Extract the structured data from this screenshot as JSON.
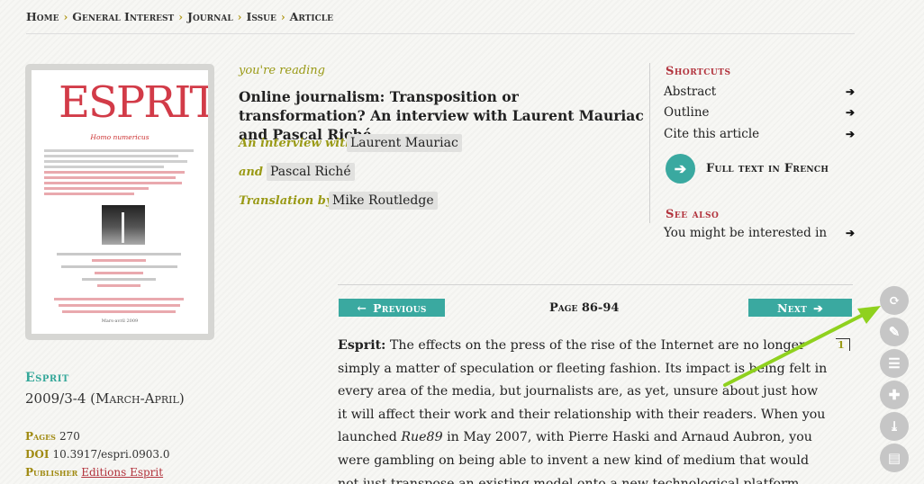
{
  "breadcrumb": {
    "items": [
      "Home",
      "General Interest",
      "Journal",
      "Issue",
      "Article"
    ],
    "sep": "›"
  },
  "cover": {
    "logo": "ESPRIT",
    "subtitle": "Homo numericus",
    "date": "Mars-avril 2009"
  },
  "journal": {
    "name": "Esprit",
    "issue": "2009/3-4 (March-April)",
    "pages_label": "Pages",
    "pages_value": "270",
    "doi_label": "DOI",
    "doi_value": "10.3917/espri.0903.0",
    "publisher_label": "Publisher",
    "publisher_value": "Editions Esprit"
  },
  "article": {
    "reading_label": "you're reading",
    "title": "Online journalism: Transposition or transformation? An interview with Laurent Mauriac and Pascal Riché",
    "roles": [
      {
        "label": "An interview with",
        "person": "Laurent Mauriac"
      },
      {
        "label": "and",
        "person": "Pascal Riché"
      },
      {
        "label": "Translation by",
        "person": "Mike Routledge"
      }
    ]
  },
  "shortcuts": {
    "heading": "Shortcuts",
    "items": [
      "Abstract",
      "Outline",
      "Cite this article"
    ],
    "fulltext": "Full text in French",
    "see_also_heading": "See also",
    "see_also_item": "You might be interested in",
    "arrow": "➔"
  },
  "nav": {
    "previous": "Previous",
    "previous_icon": "←",
    "next": "Next",
    "next_icon": "➔",
    "page": "Page 86-94"
  },
  "body": {
    "speaker": "Esprit:",
    "text_before": " The effects on the press of the rise of the Internet are no longer simply a matter of speculation or fleeting fashion. Its impact is being felt in every area of the media, but journalists are, as yet, unsure about just how it will affect their work and their relationship with their readers. When you launched ",
    "italic": "Rue89",
    "text_after": " in May 2007, with Pierre Haski and Arnaud Aubron, you were gambling on being able to invent a new kind of medium that would not just transpose an existing model onto a new technological platform.",
    "footnote": "1"
  },
  "tools": [
    {
      "name": "translate-icon",
      "glyph": "⟳"
    },
    {
      "name": "annotate-icon",
      "glyph": "✎"
    },
    {
      "name": "outline-icon",
      "glyph": "☰"
    },
    {
      "name": "bookmark-add-icon",
      "glyph": "✚"
    },
    {
      "name": "pdf-icon",
      "glyph": "⤓"
    },
    {
      "name": "print-icon",
      "glyph": "▤"
    }
  ],
  "colors": {
    "accent_teal": "#3aa9a0",
    "accent_red": "#b2333d",
    "accent_olive": "#9a9a16",
    "annotation_green": "#8fd11e"
  }
}
